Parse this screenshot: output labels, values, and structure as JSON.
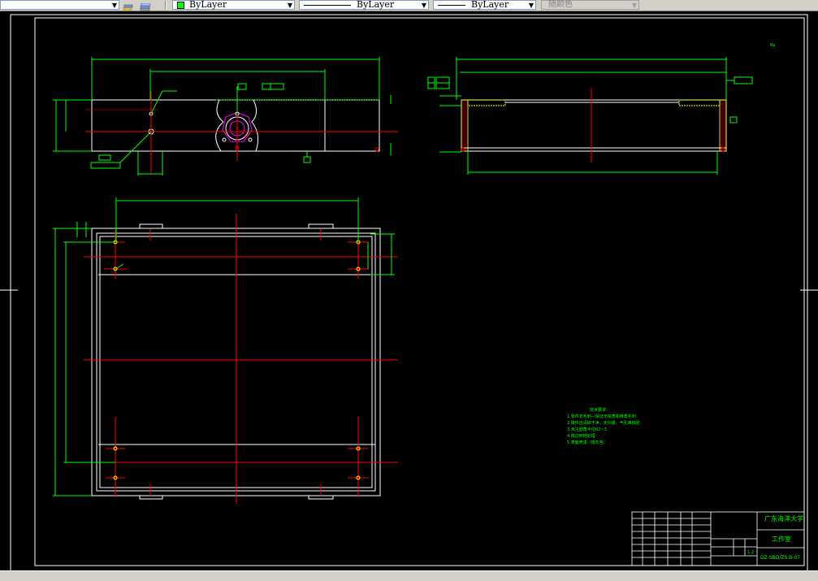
{
  "toolbar": {
    "color_control": {
      "value": "ByLayer",
      "swatch_color": "#00ff00"
    },
    "linetype_control": {
      "value": "ByLayer"
    },
    "lineweight_control": {
      "value": "ByLayer"
    },
    "plotstyle_control": {
      "value": "随颜色"
    },
    "icons": [
      "layer-previous-icon",
      "layer-states-icon"
    ]
  },
  "colors": {
    "background": "#000000",
    "geometry": "#ffffff",
    "centerline": "#ff0000",
    "dimension": "#00ff00",
    "annotation_magenta": "#ff00ff",
    "hatch": "#ffff00"
  },
  "drawing": {
    "tech_requirements": {
      "heading": "技术要求",
      "items": [
        "1.零件去毛刺—保证无锐角和棱角毛刺",
        "2.铸件应清除干净，无沙眼、气孔等缺陷",
        "3.未注圆角半径R2~3",
        "4.锐边倒钝处理",
        "5.表面喷漆（银灰色）"
      ]
    },
    "title_block": {
      "school": "广东海洋大学",
      "studio": "工作室",
      "drawing_number": "DZ-SBD/ZS.B-07",
      "scale": "1:2"
    },
    "roughness_mark": "Ra"
  }
}
